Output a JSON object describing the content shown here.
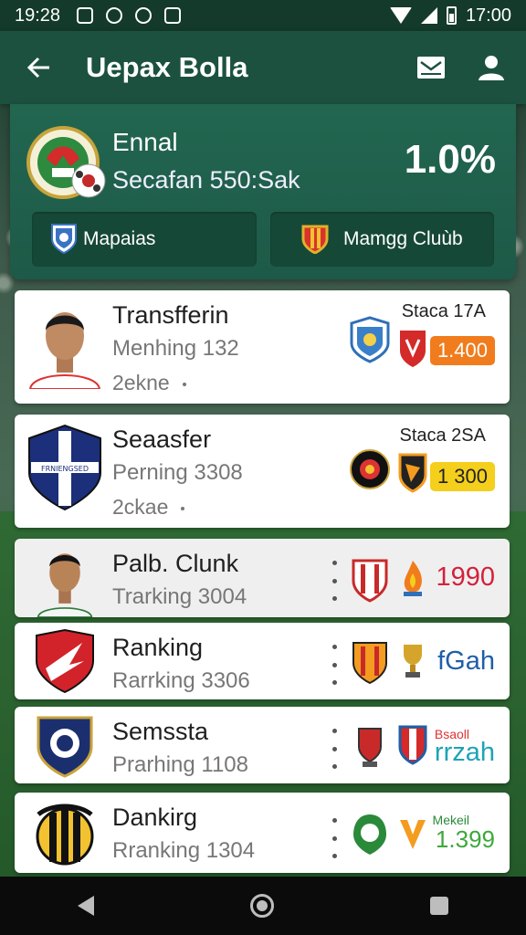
{
  "status_bar": {
    "time": "19:28",
    "clock_right": "17:00"
  },
  "app_bar": {
    "title": "Uepax Bolla",
    "icons": [
      "back-arrow-icon",
      "mail-icon",
      "profile-icon"
    ]
  },
  "header": {
    "name": "Ennal",
    "subtitle": "Secafan 550:Sak",
    "percentage": "1.0%",
    "buttons": [
      {
        "label": "Mapaias",
        "icon": "blue-shield-icon"
      },
      {
        "label": "Mamgg Cluùb",
        "icon": "red-yellow-crest-icon"
      }
    ]
  },
  "list": [
    {
      "title": "Transfferin",
      "line2": "Menhing 132",
      "line3": "2ekne",
      "top_right": "Staca 17A",
      "value": "1.400",
      "value_color": "#f07c1e"
    },
    {
      "title": "Seaasfer",
      "line2": "Perning 3308",
      "line3": "2ckae",
      "top_right": "Staca 2SA",
      "value": "1 300",
      "value_color": "#f4cf1c"
    },
    {
      "title": "Palb. Clunk",
      "line2": "Trarking 3004",
      "value": "1990",
      "value_color": "#d3213b"
    },
    {
      "title": "Ranking",
      "line2": "Rarrking 3306",
      "value": "fGah",
      "value_color": "#1f5fa8"
    },
    {
      "title": "Semssta",
      "line2": "Prarhing 1108",
      "value": "rrzah",
      "value_color": "#1ea3b7",
      "value_label": "Bsaoll"
    },
    {
      "title": "Dankirg",
      "line2": "Rranking 1304",
      "value": "1.399",
      "value_color": "#3ea83b",
      "value_label": "Mekeil"
    }
  ],
  "badges": {
    "fc_text": "FRNIENGSED"
  },
  "colors": {
    "app_bar": "#1c5140",
    "header": "#226650",
    "status": "#143a2b"
  }
}
